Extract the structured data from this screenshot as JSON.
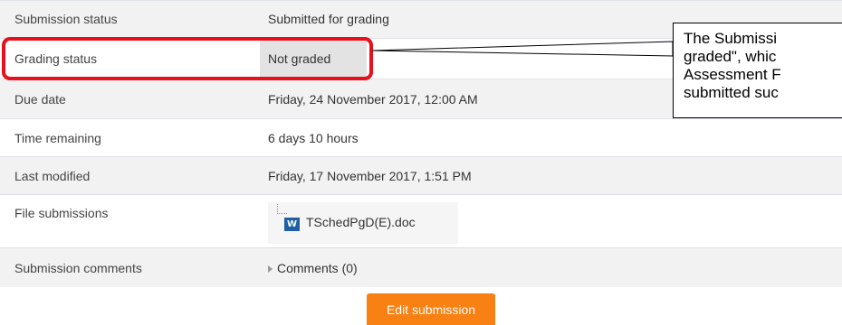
{
  "rows": [
    {
      "label": "Submission status",
      "value": "Submitted for grading"
    },
    {
      "label": "Grading status",
      "value": "Not graded"
    },
    {
      "label": "Due date",
      "value": "Friday, 24 November 2017, 12:00 AM"
    },
    {
      "label": "Time remaining",
      "value": "6 days 10 hours"
    },
    {
      "label": "Last modified",
      "value": "Friday, 17 November 2017, 1:51 PM"
    },
    {
      "label": "File submissions",
      "file_name": "TSchedPgD(E).doc",
      "file_icon": "word-document-icon",
      "file_icon_glyph": "W"
    },
    {
      "label": "Submission comments",
      "value": "Comments (0)"
    }
  ],
  "edit_button_label": "Edit submission",
  "callout": {
    "lines": [
      "The Submissi",
      "graded\", whic",
      "Assessment F",
      "submitted suc"
    ]
  },
  "colors": {
    "accent": "#f98012",
    "highlight_border": "#e8101c"
  }
}
